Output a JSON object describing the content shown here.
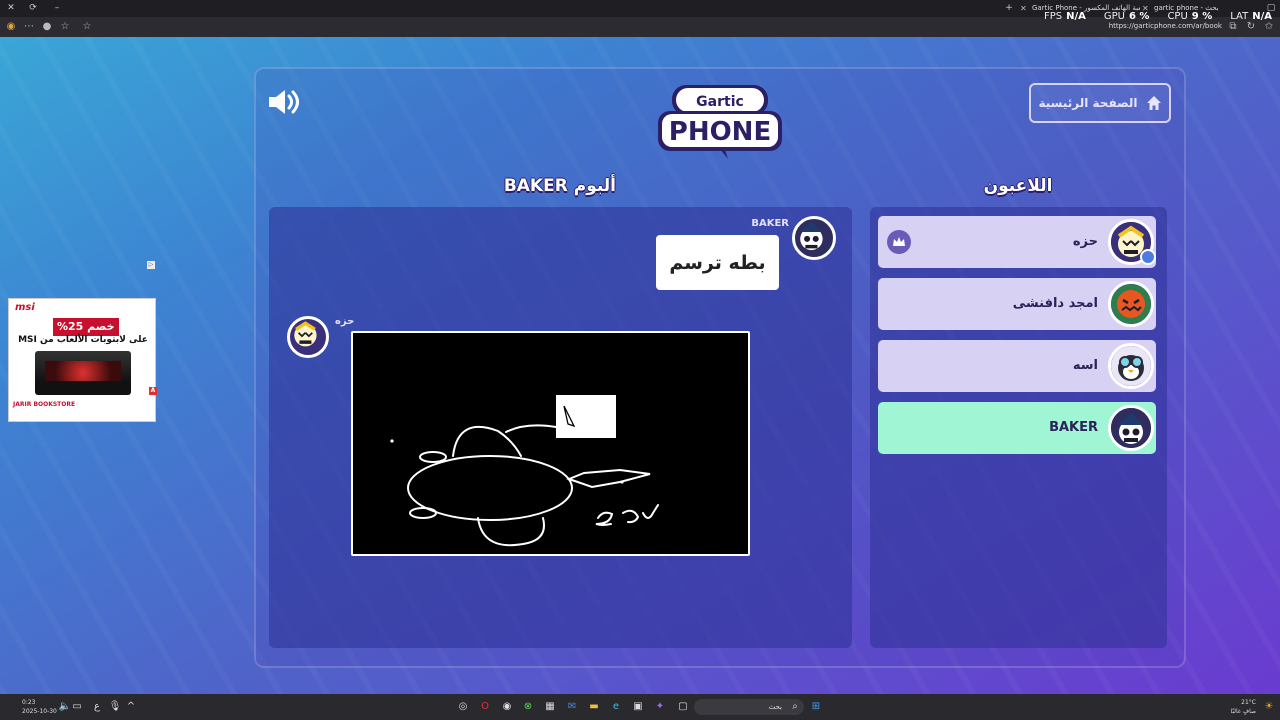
{
  "browser": {
    "tabs": [
      {
        "label": "Gartic Phone - لعبة الهاتف المكسور"
      },
      {
        "label": "gartic phone - بحث"
      }
    ],
    "url": "https://garticphone.com/ar/book",
    "window_close": "✕",
    "new_tab": "+"
  },
  "stats": {
    "fps_label": "FPS",
    "fps_value": "N/A",
    "gpu_label": "GPU",
    "gpu_value": "6 %",
    "cpu_label": "CPU",
    "cpu_value": "9 %",
    "lat_label": "LAT",
    "lat_value": "N/A"
  },
  "game": {
    "home_button": "الصفحة الرئيسية",
    "logo_top": "Gartic",
    "logo_bottom": "PHONE",
    "album_title": "ألبوم BAKER",
    "players_title": "اللاعبون",
    "album": {
      "baker_name": "BAKER",
      "prompt_text": "بطه ترسم",
      "drawer_name": "حزه"
    },
    "players": [
      {
        "name": "حزه",
        "host": true,
        "active": false
      },
      {
        "name": "امجد دافنشى",
        "host": false,
        "active": false
      },
      {
        "name": "اسه",
        "host": false,
        "active": false
      },
      {
        "name": "BAKER",
        "host": false,
        "active": true
      }
    ],
    "colors": {
      "active_player": "#9ff5d4",
      "player_row": "#d7d2f3"
    }
  },
  "ad": {
    "brand": "msi",
    "discount": "خصم 25%",
    "line": "على لابتوبات الألعاب من MSI",
    "store": "JARIR BOOKSTORE"
  },
  "taskbar": {
    "time": "0:23",
    "date": "2025-10-30",
    "search_placeholder": "بحث",
    "weather": "21°C",
    "weather_desc": "صافٍ غالبًا"
  }
}
